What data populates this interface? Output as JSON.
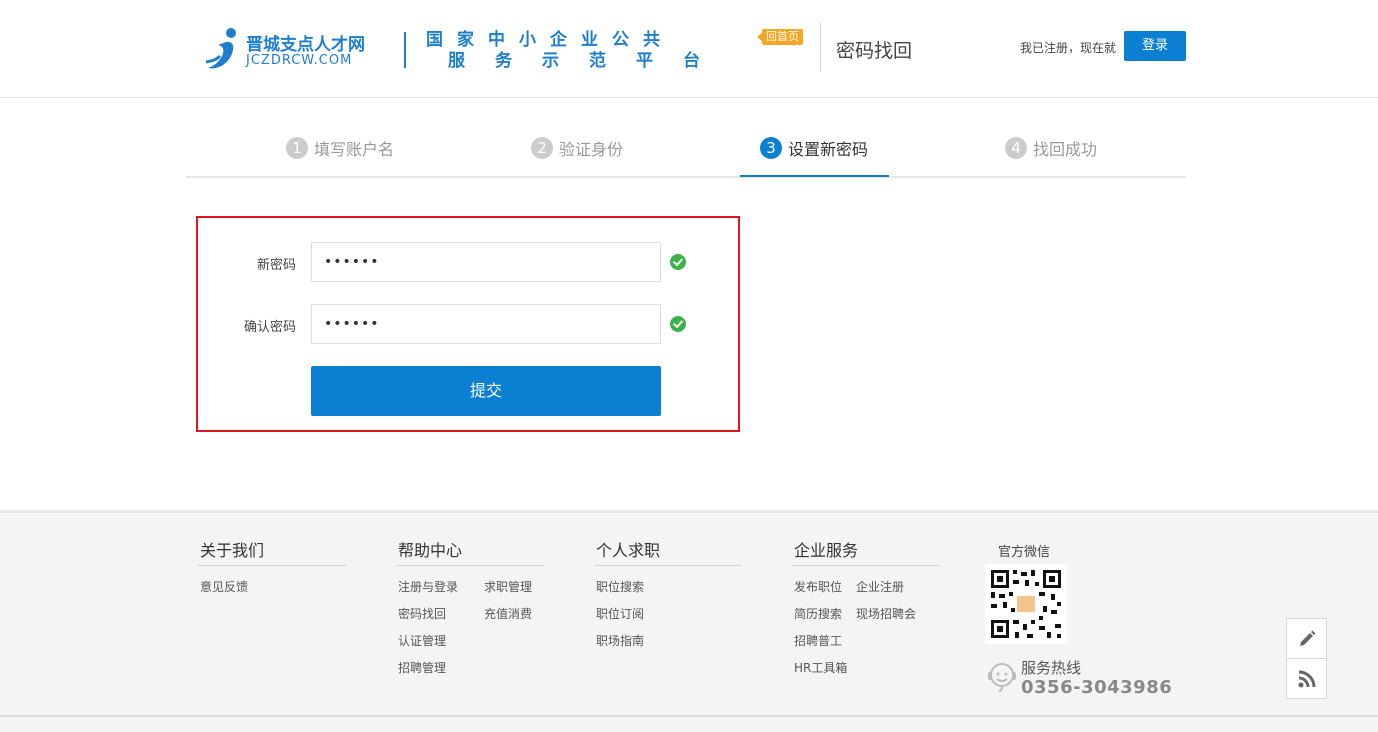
{
  "header": {
    "logo_cn": "晋城支点人才网",
    "logo_en": "JCZDRCW.COM",
    "slogan_line1": "国家中小企业公共",
    "slogan_line2": "服务示范平台",
    "home_badge": "回首页",
    "page_name": "密码找回",
    "login_tip": "我已注册，现在就",
    "login_button": "登录"
  },
  "steps": [
    {
      "num": "1",
      "label": "填写账户名",
      "active": false
    },
    {
      "num": "2",
      "label": "验证身份",
      "active": false
    },
    {
      "num": "3",
      "label": "设置新密码",
      "active": true
    },
    {
      "num": "4",
      "label": "找回成功",
      "active": false
    }
  ],
  "form": {
    "new_password_label": "新密码",
    "new_password_value": "••••••",
    "confirm_password_label": "确认密码",
    "confirm_password_value": "••••••",
    "submit_label": "提交"
  },
  "footer": {
    "columns": [
      {
        "title": "关于我们",
        "links": [
          "意见反馈"
        ]
      },
      {
        "title": "帮助中心",
        "links": [
          "注册与登录",
          "求职管理",
          "密码找回",
          "充值消费",
          "认证管理",
          "招聘管理"
        ]
      },
      {
        "title": "个人求职",
        "links": [
          "职位搜索",
          "职位订阅",
          "职场指南"
        ]
      },
      {
        "title": "企业服务",
        "links": [
          "发布职位",
          "企业注册",
          "简历搜索",
          "现场招聘会",
          "招聘普工",
          "HR工具箱"
        ]
      }
    ],
    "wechat_title": "官方微信",
    "hotline_label": "服务热线",
    "hotline_number": "0356-3043986"
  },
  "colors": {
    "accent": "#0b7fd1",
    "brand": "#1e7fd0",
    "highlight_border": "#e0161c",
    "success": "#3cb34a",
    "badge": "#f5a623"
  },
  "icons": [
    "logo-mark-icon",
    "check-circle-icon",
    "headset-icon",
    "pencil-icon",
    "rss-icon",
    "qr-code-icon"
  ]
}
